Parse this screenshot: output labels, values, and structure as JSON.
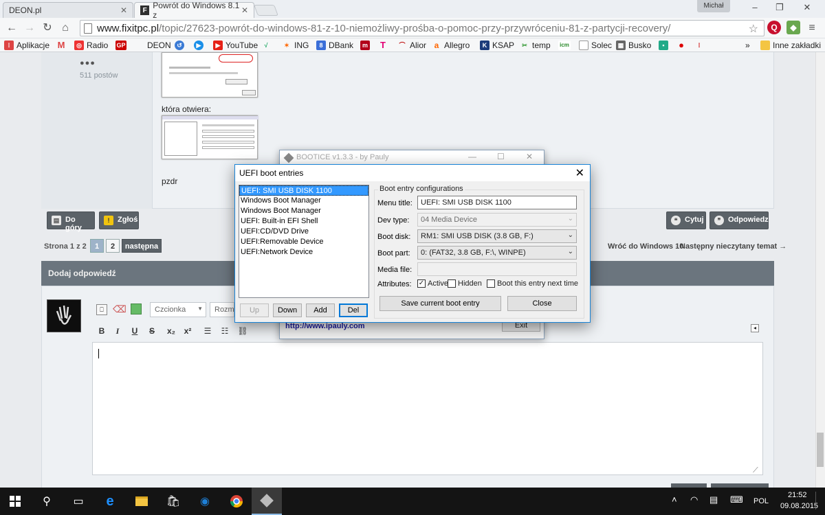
{
  "browser": {
    "tabs": [
      {
        "label": "DEON.pl",
        "active": false
      },
      {
        "label": "Powrót do Windows 8.1 z",
        "active": true,
        "favicon": "F"
      }
    ],
    "user": "Michał",
    "url_host": "www.fixitpc.pl",
    "url_path": "/topic/27623-powrót-do-windows-81-z-10-niemożliwy-prośba-o-pomoc-przy-przywróceniu-81-z-partycji-recovery/",
    "bookmarks": [
      "Aplikacje",
      "Radio",
      "DEON",
      "YouTube",
      "ING",
      "DBank",
      "Alior",
      "Allegro",
      "KSAP",
      "temp",
      "Solec",
      "Busko",
      "Inne zakładki"
    ],
    "bookmarks_more": "»"
  },
  "forum": {
    "dots": "●●●",
    "post_count": "511 postów",
    "text_opens": "która otwiera:",
    "text_pzdr": "pzdr",
    "btn_top": "Do góry",
    "btn_report": "Zgłoś",
    "btn_quote": "Cytuj",
    "btn_reply": "Odpowiedz",
    "pager_label": "Strona 1 z 2",
    "pages": [
      "1",
      "2"
    ],
    "next": "następna",
    "back_link": "Wróć do Windows 10",
    "next_unread": "Następny nieczytany temat →",
    "reply_header": "Dodaj odpowiedź",
    "font_select": "Czcionka",
    "size_select": "Rozmi"
  },
  "bootice": {
    "title": "BOOTICE v1.3.3 - by Pauly",
    "url": "http://www.ipauly.com",
    "exit": "Exit"
  },
  "uefi": {
    "title": "UEFI boot entries",
    "entries": [
      "UEFI: SMI USB DISK 1100",
      "Windows Boot Manager",
      "Windows Boot Manager",
      "UEFI: Built-in EFI Shell",
      "UEFI:CD/DVD Drive",
      "UEFI:Removable Device",
      "UEFI:Network Device"
    ],
    "selected_index": 0,
    "btn_up": "Up",
    "btn_down": "Down",
    "btn_add": "Add",
    "btn_del": "Del",
    "group_title": "Boot entry configurations",
    "lbl_menu_title": "Menu title:",
    "menu_title": "UEFI: SMI USB DISK 1100",
    "lbl_dev_type": "Dev type:",
    "dev_type": "04  Media Device",
    "lbl_boot_disk": "Boot disk:",
    "boot_disk": "RM1: SMI USB DISK (3.8 GB, F:)",
    "lbl_boot_part": "Boot part:",
    "boot_part": "0: (FAT32,    3.8 GB, F:\\, WINPE)",
    "lbl_media_file": "Media file:",
    "media_file": "",
    "lbl_attributes": "Attributes:",
    "attr_active": "Active",
    "attr_active_checked": true,
    "attr_hidden": "Hidden",
    "attr_hidden_checked": false,
    "attr_next": "Boot this entry next time",
    "attr_next_checked": false,
    "btn_save": "Save current boot entry",
    "btn_close": "Close"
  },
  "taskbar": {
    "lang": "POL",
    "time": "21:52",
    "date": "09.08.2015"
  },
  "colors": {
    "selection": "#3399ff",
    "dialog_border": "#1883d7",
    "forum_header": "#6b757e",
    "taskbar": "#141414"
  }
}
